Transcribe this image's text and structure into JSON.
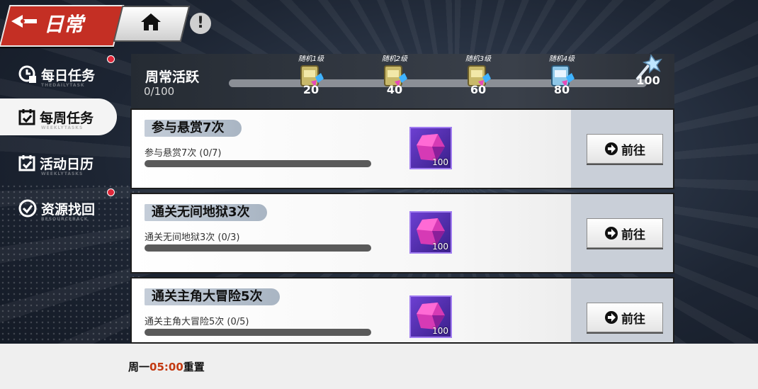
{
  "header": {
    "tab_label": "日常"
  },
  "sidebar": {
    "items": [
      {
        "label": "每日任务",
        "sub": "THEDAILYTASK"
      },
      {
        "label": "每周任务",
        "sub": "WEEKLYTASKS"
      },
      {
        "label": "活动日历",
        "sub": "WEEKLYTASKS"
      },
      {
        "label": "资源找回",
        "sub": "RESOURCEBACK"
      }
    ]
  },
  "activity": {
    "title": "周常活跃",
    "progress": "0/100",
    "progress_fraction": 0,
    "milestones": [
      {
        "label": "随机1级",
        "value": "20",
        "badge": "20"
      },
      {
        "label": "随机2级",
        "value": "40",
        "badge": ""
      },
      {
        "label": "随机3级",
        "value": "60",
        "badge": ""
      },
      {
        "label": "随机4级",
        "value": "80",
        "badge": ""
      },
      {
        "label": "",
        "value": "100",
        "badge": ""
      }
    ]
  },
  "tasks": [
    {
      "title": "参与悬赏7次",
      "desc": "参与悬赏7次 (0/7)",
      "reward": "100",
      "button": "前往",
      "progress_fraction": 0
    },
    {
      "title": "通关无间地狱3次",
      "desc": "通关无间地狱3次 (0/3)",
      "reward": "100",
      "button": "前往",
      "progress_fraction": 0
    },
    {
      "title": "通关主角大冒险5次",
      "desc": "通关主角大冒险5次 (0/5)",
      "reward": "100",
      "button": "前往",
      "progress_fraction": 0
    }
  ],
  "footer": {
    "reset_day": "周一",
    "reset_time": "05:00",
    "reset_suffix": "重置"
  },
  "colors": {
    "accent_red": "#c42f24",
    "reset_time": "#c33a12",
    "notify_dot": "#e0283a"
  }
}
